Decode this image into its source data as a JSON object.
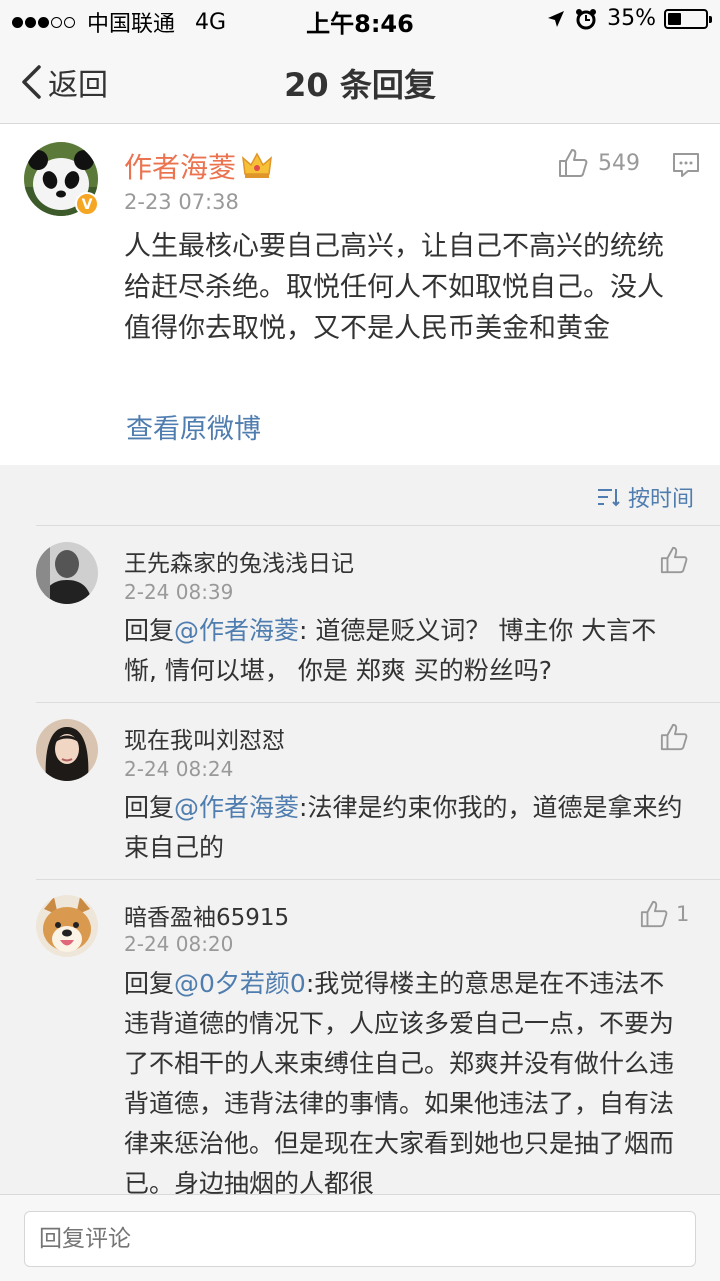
{
  "status_bar": {
    "carrier": "中国联通",
    "network": "4G",
    "time": "上午8:46",
    "battery": "35%",
    "battery_level": 0.35
  },
  "nav": {
    "back_label": "返回",
    "title": "20 条回复"
  },
  "post": {
    "author": "作者海菱",
    "time": "2-23 07:38",
    "like_count": "549",
    "text": "人生最核心要自己高兴，让自己不高兴的统统给赶尽杀绝。取悦任何人不如取悦自己。没人值得你去取悦，又不是人民币美金和黄金",
    "view_original": "查看原微博",
    "verified_badge": "V",
    "icons": [
      "avatar-panda",
      "verified-badge-icon",
      "crown-icon",
      "thumb-up-icon",
      "comment-icon"
    ]
  },
  "sort": {
    "label": "按时间"
  },
  "comments": [
    {
      "name": "王先森家的兔浅浅日记",
      "time": "2-24 08:39",
      "likes": "",
      "reply_prefix": "回复",
      "mention": "@作者海菱",
      "text": ": 道德是贬义词？ 博主你  大言不惭, 情何以堪，  你是 郑爽 买的粉丝吗?"
    },
    {
      "name": "现在我叫刘怼怼",
      "time": "2-24 08:24",
      "likes": "",
      "reply_prefix": "回复",
      "mention": "@作者海菱",
      "text": ":法律是约束你我的，道德是拿来约束自己的"
    },
    {
      "name": "暗香盈袖65915",
      "time": "2-24 08:20",
      "likes": "1",
      "reply_prefix": "回复",
      "mention": "@0夕若颜0",
      "text": ":我觉得楼主的意思是在不违法不违背道德的情况下，人应该多爱自己一点，不要为了不相干的人来束缚住自己。郑爽并没有做什么违背道德，违背法律的事情。如果他违法了，自有法律来惩治他。但是现在大家看到她也只是抽了烟而已。身边抽烟的人都很"
    }
  ],
  "reply_bar": {
    "placeholder": "回复评论"
  },
  "colors": {
    "author_orange": "#eb7350",
    "link_blue": "#507daf",
    "muted_gray": "#999999"
  }
}
